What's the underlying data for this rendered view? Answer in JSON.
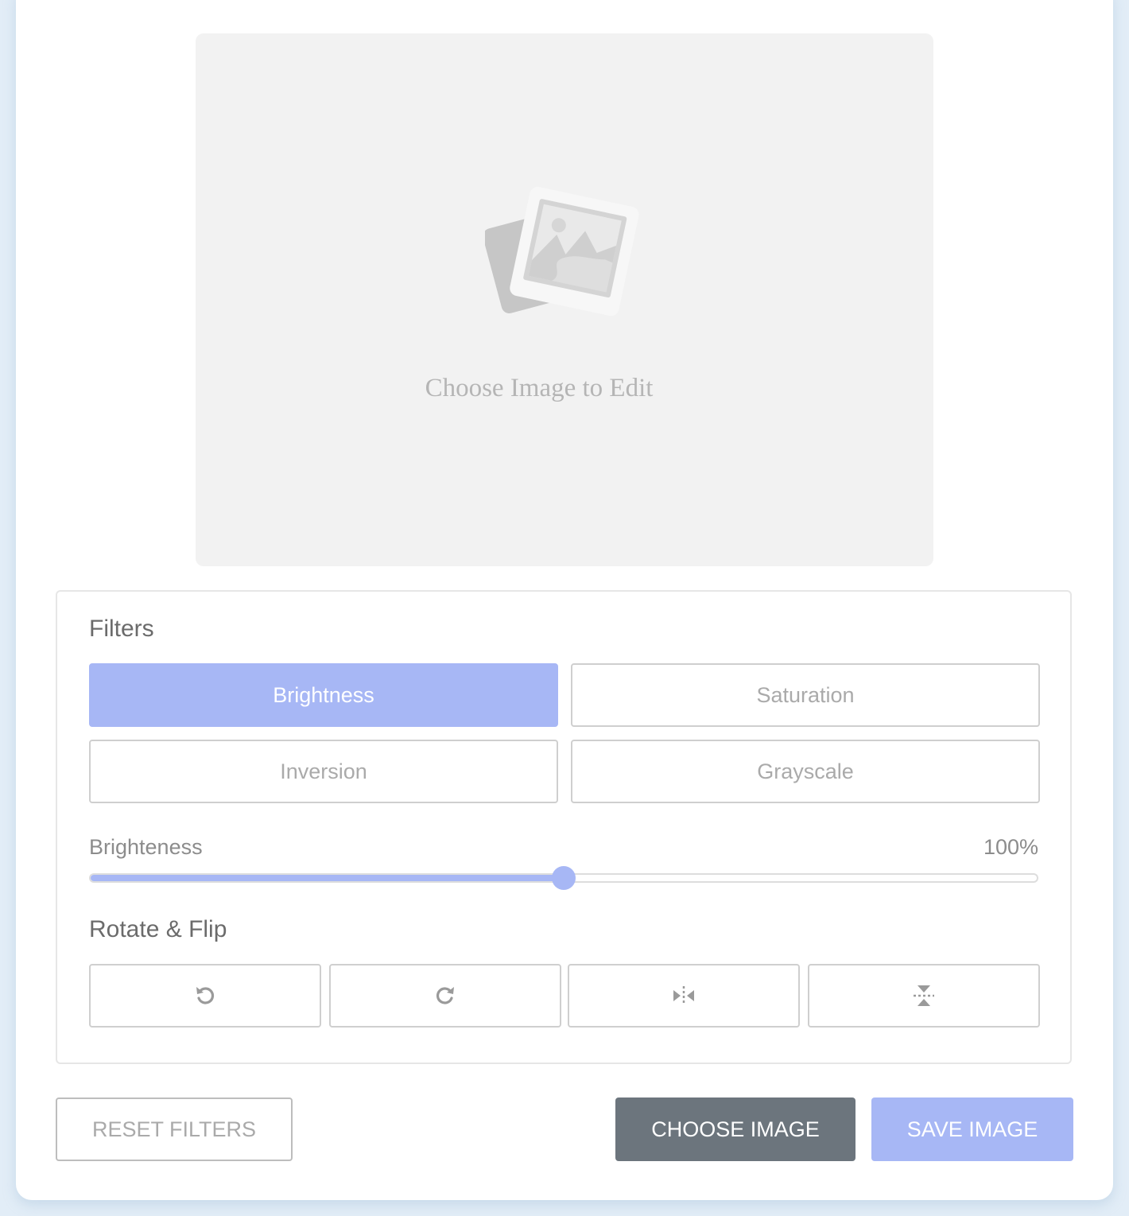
{
  "preview": {
    "placeholder_text": "Choose Image to Edit",
    "icon": "image-placeholder-icon"
  },
  "filters": {
    "title": "Filters",
    "options": [
      {
        "label": "Brightness",
        "active": true
      },
      {
        "label": "Saturation",
        "active": false
      },
      {
        "label": "Inversion",
        "active": false
      },
      {
        "label": "Grayscale",
        "active": false
      }
    ]
  },
  "slider": {
    "label": "Brighteness",
    "value_text": "100%",
    "fraction": 0.5
  },
  "rotate_flip": {
    "title": "Rotate & Flip",
    "buttons": [
      {
        "icon": "rotate-left-icon"
      },
      {
        "icon": "rotate-right-icon"
      },
      {
        "icon": "flip-horizontal-icon"
      },
      {
        "icon": "flip-vertical-icon"
      }
    ]
  },
  "actions": {
    "reset": "RESET FILTERS",
    "choose": "CHOOSE IMAGE",
    "save": "SAVE IMAGE"
  },
  "colors": {
    "accent": "#a7b7f5",
    "choose_button": "#6c757d",
    "background": "#e2edf7"
  }
}
